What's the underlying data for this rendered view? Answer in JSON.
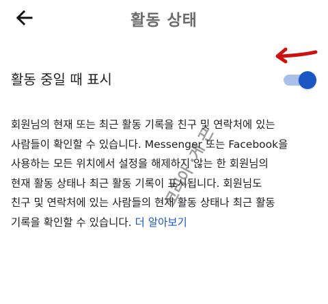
{
  "header": {
    "title": "활동 상태",
    "back_icon": "arrow-left-icon"
  },
  "setting": {
    "label": "활동 중일 때 표시",
    "enabled": true,
    "accent_color": "#1a56c4",
    "track_color": "#a9c1ea"
  },
  "description": {
    "lines": [
      "회원님의 현재 또는 최근 활동 기록을 친구 및 연락처에 있는",
      "사람들이 확인할 수 있습니다. Messenger 또는 Facebook을",
      "사용하는 모든 위치에서 설정을 해제하지 않는 한 회원님의",
      "현재 활동 상태나 최근 활동 기록이 표시됩니다. 회원님도",
      "친구 및 연락처에 있는 사람들의 현재 활동 상태나 최근 활동",
      "기록을 확인할 수 있습니다."
    ],
    "link_text": "더 알아보기"
  },
  "annotation": {
    "arrow_color": "#cc1111"
  },
  "watermark": {
    "text": "코리아 ·게 끈"
  }
}
